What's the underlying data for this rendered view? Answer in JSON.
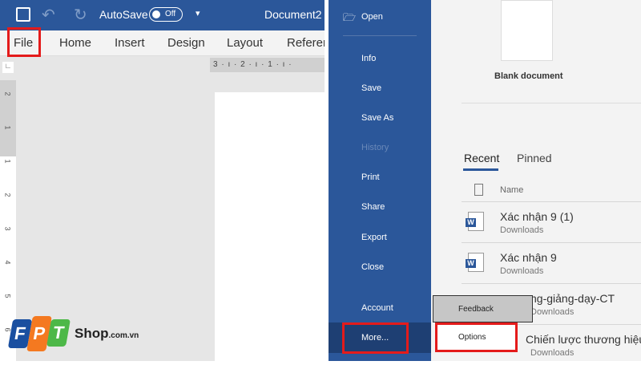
{
  "titlebar": {
    "autosave": "AutoSave",
    "toggle": "Off",
    "doc": "Document2"
  },
  "ribbon": {
    "tabs": [
      "File",
      "Home",
      "Insert",
      "Design",
      "Layout",
      "Referen"
    ]
  },
  "ruler": {
    "h": "3 · ı · 2 · ı · 1 · ı ·",
    "v": [
      "2",
      "1",
      "1",
      "2",
      "3",
      "4",
      "5",
      "6"
    ]
  },
  "backstage": {
    "items": [
      "Open",
      "Info",
      "Save",
      "Save As",
      "History",
      "Print",
      "Share",
      "Export",
      "Close",
      "Account",
      "More..."
    ]
  },
  "content": {
    "blank": "Blank document",
    "tabs": [
      "Recent",
      "Pinned"
    ],
    "name_header": "Name",
    "files": [
      {
        "name": "Xác nhận 9 (1)",
        "loc": "Downloads"
      },
      {
        "name": "Xác nhận 9",
        "loc": "Downloads"
      },
      {
        "name": "ng-giảng-dạy-CT",
        "loc": "Downloads"
      },
      {
        "name": "Chiến lược thương hiệu",
        "loc": "Downloads"
      }
    ]
  },
  "popup": {
    "feedback": "Feedback",
    "options": "Options"
  },
  "logo": {
    "text": "FPT",
    "shop": "Shop",
    ".com.vn": ".com.vn"
  },
  "colors": {
    "word_blue": "#2b579a",
    "highlight": "#e41b1b"
  }
}
